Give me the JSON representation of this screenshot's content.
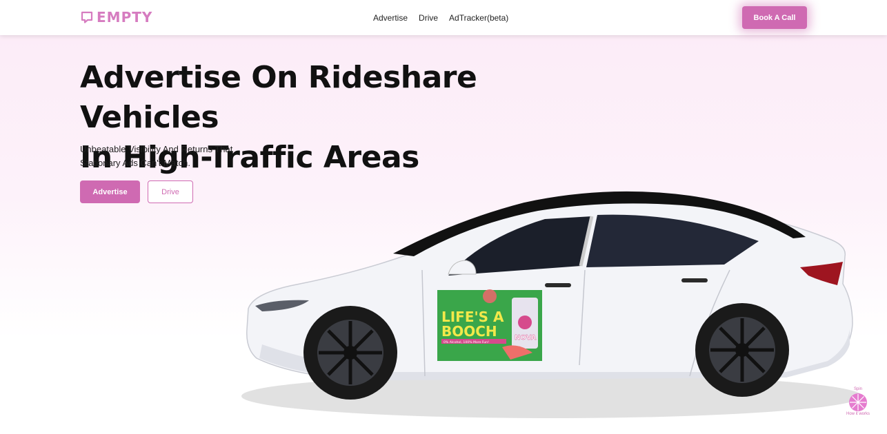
{
  "brand": {
    "name": "EMPTY",
    "color": "#d67cc0",
    "icon": "chat-bubble-icon"
  },
  "nav": {
    "links": [
      "Advertise",
      "Drive",
      "AdTracker(beta)"
    ],
    "cta_label": "Book A Call"
  },
  "hero": {
    "title_line1": "Advertise On Rideshare Vehicles",
    "title_line2": "In High-Traffic Areas",
    "subtitle_line1": "Unbeatable Visibility And Returns That",
    "subtitle_line2": "Stationary Ads Can't Match.",
    "primary_button": "Advertise",
    "secondary_button": "Drive"
  },
  "ad": {
    "headline_line1": "LIFE'S A",
    "headline_line2": "BOOCH",
    "tagline": "0% Alcohol, 100% More Fun!",
    "brand": "NOVA"
  },
  "widget": {
    "top_label": "Spin",
    "bottom_label": "How it works"
  },
  "colors": {
    "accent": "#cf6ab2",
    "hero_bg": "#fcebf7",
    "ad_green": "#3aa64a",
    "ad_yellow": "#f3e84a"
  }
}
